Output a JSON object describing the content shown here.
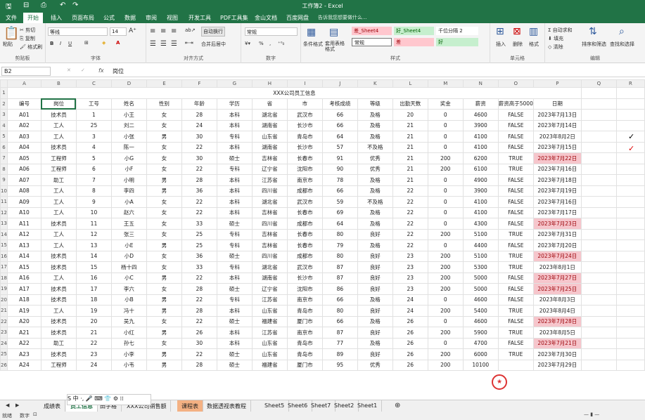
{
  "app": {
    "title": "工作簿2 - Excel"
  },
  "tabs": [
    "文件",
    "开始",
    "插入",
    "页面布局",
    "公式",
    "数据",
    "审阅",
    "视图",
    "开发工具",
    "PDF工具集",
    "金山文档",
    "百度网盘"
  ],
  "active_tab": "开始",
  "tell_me": "告诉我您想要做什么...",
  "ribbon": {
    "clipboard": {
      "paste": "粘贴",
      "cut": "剪切",
      "copy": "复制",
      "painter": "格式刷",
      "label": "剪贴板"
    },
    "font": {
      "name": "等线",
      "size": "14",
      "label": "字体",
      "bold": "B",
      "italic": "I",
      "underline": "U",
      "color_a": "A"
    },
    "align": {
      "wrap": "自动换行",
      "merge": "合并后居中",
      "label": "对齐方式"
    },
    "number": {
      "format": "常规",
      "percent": "%",
      "comma": ",",
      "label": "数字"
    },
    "styles": {
      "cond": "条件格式",
      "table": "套用表格格式",
      "s1": "差_Sheet4",
      "s2": "好_Sheet4",
      "s3": "千位分隔 2",
      "s4": "常规",
      "s5": "差",
      "s6": "好",
      "label": "样式"
    },
    "cells": {
      "insert": "插入",
      "delete": "删除",
      "format": "格式",
      "label": "单元格"
    },
    "editing": {
      "autosum": "自动求和",
      "fill": "填充",
      "clear": "清除",
      "sort": "排序和筛选",
      "find": "查找和选择",
      "label": "编辑"
    }
  },
  "formula_bar": {
    "name_box": "B2",
    "fx": "fx",
    "content": "岗位"
  },
  "columns": [
    "A",
    "B",
    "C",
    "D",
    "E",
    "F",
    "G",
    "H",
    "I",
    "J",
    "K",
    "L",
    "M",
    "N",
    "O",
    "P",
    "Q",
    "R"
  ],
  "sheet_title": "XXX公司员工信息",
  "headers": [
    "编号",
    "岗位",
    "工号",
    "姓名",
    "性别",
    "年龄",
    "学历",
    "省",
    "市",
    "考核成绩",
    "等级",
    "出勤天数",
    "奖金",
    "薪资",
    "薪资高于5000",
    "日期"
  ],
  "rows": [
    [
      "A01",
      "技术员",
      "1",
      "小王",
      "女",
      "28",
      "本科",
      "湖北省",
      "武汉市",
      "66",
      "及格",
      "20",
      "0",
      "4600",
      "FALSE",
      "2023年7月13日"
    ],
    [
      "A02",
      "工人",
      "25",
      "刘二",
      "女",
      "24",
      "本科",
      "湖南省",
      "长沙市",
      "66",
      "及格",
      "21",
      "0",
      "3900",
      "FALSE",
      "2023年7月14日"
    ],
    [
      "A03",
      "工人",
      "3",
      "小张",
      "男",
      "30",
      "专科",
      "山东省",
      "青岛市",
      "64",
      "及格",
      "21",
      "0",
      "4100",
      "FALSE",
      "2023年8月2日"
    ],
    [
      "A04",
      "技术员",
      "4",
      "陈一",
      "女",
      "22",
      "本科",
      "湖南省",
      "长沙市",
      "57",
      "不及格",
      "21",
      "0",
      "4100",
      "FALSE",
      "2023年7月15日"
    ],
    [
      "A05",
      "工程师",
      "5",
      "小G",
      "女",
      "30",
      "硕士",
      "吉林省",
      "长春市",
      "91",
      "优秀",
      "21",
      "200",
      "6200",
      "TRUE",
      "2023年7月22日"
    ],
    [
      "A06",
      "工程师",
      "6",
      "小F",
      "女",
      "22",
      "专科",
      "辽宁省",
      "沈阳市",
      "90",
      "优秀",
      "21",
      "200",
      "6100",
      "TRUE",
      "2023年7月16日"
    ],
    [
      "A07",
      "助工",
      "7",
      "小明",
      "男",
      "28",
      "本科",
      "江苏省",
      "南京市",
      "78",
      "及格",
      "21",
      "0",
      "4900",
      "FALSE",
      "2023年7月18日"
    ],
    [
      "A08",
      "工人",
      "8",
      "李四",
      "男",
      "36",
      "本科",
      "四川省",
      "成都市",
      "66",
      "及格",
      "22",
      "0",
      "3900",
      "FALSE",
      "2023年7月19日"
    ],
    [
      "A09",
      "工人",
      "9",
      "小A",
      "女",
      "22",
      "本科",
      "湖北省",
      "武汉市",
      "59",
      "不及格",
      "22",
      "0",
      "4100",
      "FALSE",
      "2023年7月16日"
    ],
    [
      "A10",
      "工人",
      "10",
      "赵六",
      "女",
      "22",
      "本科",
      "吉林省",
      "长春市",
      "69",
      "及格",
      "22",
      "0",
      "4100",
      "FALSE",
      "2023年7月17日"
    ],
    [
      "A11",
      "技术员",
      "11",
      "王五",
      "女",
      "33",
      "硕士",
      "四川省",
      "成都市",
      "64",
      "及格",
      "22",
      "0",
      "4300",
      "FALSE",
      "2023年7月23日"
    ],
    [
      "A12",
      "工人",
      "12",
      "张三",
      "女",
      "25",
      "专科",
      "吉林省",
      "长春市",
      "80",
      "良好",
      "22",
      "200",
      "5100",
      "TRUE",
      "2023年7月31日"
    ],
    [
      "A13",
      "工人",
      "13",
      "小E",
      "男",
      "25",
      "专科",
      "吉林省",
      "长春市",
      "79",
      "及格",
      "22",
      "0",
      "4400",
      "FALSE",
      "2023年7月20日"
    ],
    [
      "A14",
      "技术员",
      "14",
      "小D",
      "女",
      "36",
      "硕士",
      "四川省",
      "成都市",
      "80",
      "良好",
      "23",
      "200",
      "5100",
      "TRUE",
      "2023年7月24日"
    ],
    [
      "A15",
      "技术员",
      "15",
      "杨十四",
      "女",
      "33",
      "专科",
      "湖北省",
      "武汉市",
      "87",
      "良好",
      "23",
      "200",
      "5300",
      "TRUE",
      "2023年8月1日"
    ],
    [
      "A16",
      "工人",
      "16",
      "小C",
      "男",
      "22",
      "本科",
      "湖南省",
      "长沙市",
      "87",
      "良好",
      "23",
      "200",
      "5000",
      "FALSE",
      "2023年7月27日"
    ],
    [
      "A17",
      "技术员",
      "17",
      "李六",
      "女",
      "28",
      "硕士",
      "辽宁省",
      "沈阳市",
      "86",
      "良好",
      "23",
      "200",
      "5000",
      "FALSE",
      "2023年7月25日"
    ],
    [
      "A18",
      "技术员",
      "18",
      "小B",
      "男",
      "22",
      "专科",
      "江苏省",
      "南京市",
      "66",
      "及格",
      "24",
      "0",
      "4600",
      "FALSE",
      "2023年8月3日"
    ],
    [
      "A19",
      "工人",
      "19",
      "冯十",
      "男",
      "28",
      "本科",
      "山东省",
      "青岛市",
      "80",
      "良好",
      "24",
      "200",
      "5400",
      "TRUE",
      "2023年8月4日"
    ],
    [
      "A20",
      "技术员",
      "20",
      "吴九",
      "女",
      "22",
      "硕士",
      "福建省",
      "厦门市",
      "66",
      "及格",
      "26",
      "0",
      "4600",
      "FALSE",
      "2023年7月28日"
    ],
    [
      "A21",
      "技术员",
      "21",
      "小红",
      "男",
      "26",
      "本科",
      "江苏省",
      "南京市",
      "87",
      "良好",
      "26",
      "200",
      "5900",
      "TRUE",
      "2023年8月5日"
    ],
    [
      "A22",
      "助工",
      "22",
      "孙七",
      "女",
      "30",
      "本科",
      "山东省",
      "青岛市",
      "77",
      "及格",
      "26",
      "0",
      "4700",
      "FALSE",
      "2023年7月21日"
    ],
    [
      "A23",
      "技术员",
      "23",
      "小李",
      "男",
      "22",
      "硕士",
      "山东省",
      "青岛市",
      "89",
      "良好",
      "26",
      "200",
      "6000",
      "TRUE",
      "2023年7月30日"
    ],
    [
      "A24",
      "工程师",
      "24",
      "小韦",
      "男",
      "28",
      "硕士",
      "福建省",
      "厦门市",
      "95",
      "优秀",
      "26",
      "200",
      "10100",
      "",
      "2023年7月29日"
    ]
  ],
  "pink_rows": [
    4,
    10,
    13,
    15,
    16,
    19,
    21
  ],
  "checkmarks": {
    "row3": "✓",
    "row4": "✓"
  },
  "stamp": "★",
  "sheet_tabs": [
    "成绩表",
    "员工信息",
    "田字格",
    "XXX公司销售额",
    "课程表",
    "数据透视表教程",
    "Sheet5",
    "Sheet6",
    "Sheet7",
    "Sheet2",
    "Sheet1"
  ],
  "ime_bar": "S 中 ·, 🎤 ⌨ 👕 ⚙ ⁞⁞",
  "status": {
    "ready": "就绪",
    "mode": "数字"
  }
}
